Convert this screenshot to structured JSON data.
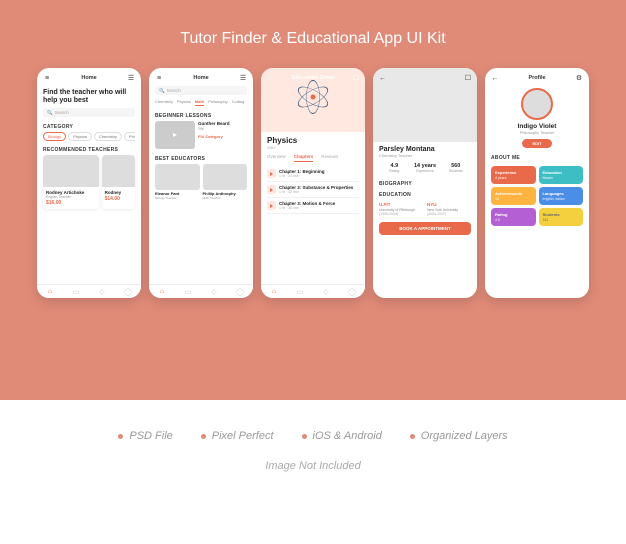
{
  "banner": {
    "title": "Tutor Finder & Educational App UI Kit"
  },
  "features": [
    "PSD File",
    "Pixel Perfect",
    "iOS & Android",
    "Organized Layers"
  ],
  "footer_note": "Image Not Included",
  "screen1": {
    "header": "Home",
    "hero": "Find the teacher who will help you best",
    "search_placeholder": "Search",
    "section_category": "CATEGORY",
    "categories": [
      "Biology",
      "Physics",
      "Chemistry",
      "Philosophy"
    ],
    "section_teachers": "RECOMMENDED TEACHERS",
    "teachers": [
      {
        "name": "Rodney Artichoke",
        "subject": "English Teacher",
        "price": "$16.00"
      },
      {
        "name": "Rodney",
        "subject": "",
        "price": "$14.00"
      }
    ]
  },
  "screen2": {
    "header": "Home",
    "search_placeholder": "Search",
    "subjects": [
      "Chemistry",
      "Physics",
      "Math",
      "Philosophy",
      "Coding"
    ],
    "section_lessons": "BEGINNER LESSONS",
    "lesson": {
      "name": "Gunther Beard",
      "views": "29k",
      "link": "FIX Category"
    },
    "section_educators": "BEST EDUCATORS",
    "educators": [
      {
        "name": "Eleanor Fant",
        "subject": "Biology Teacher"
      },
      {
        "name": "Phillip Anthrophy",
        "subject": "Math Teacher"
      }
    ]
  },
  "screen3": {
    "header": "Education Detail",
    "title": "Physics",
    "subtitle": "29k+",
    "tabs": [
      "Overview",
      "Chapters",
      "Reviews"
    ],
    "chapters": [
      {
        "name": "Chapter 1: Beginning",
        "meta": "1 hr · 24 min"
      },
      {
        "name": "Chapter 2: Substance & Properties",
        "meta": "1 hr · 42 min"
      },
      {
        "name": "Chapter 3: Motion & Force",
        "meta": "1 hr · 36 min"
      }
    ]
  },
  "screen4": {
    "name": "Parsley Montana",
    "subject": "Chemistry Teacher",
    "stats": [
      {
        "val": "4.9",
        "label": "Rating"
      },
      {
        "val": "14 years",
        "label": "Experience"
      },
      {
        "val": "560",
        "label": "Students"
      }
    ],
    "section_bio": "BIOGRAPHY",
    "section_edu": "EDUCATION",
    "education": [
      {
        "short": "U.PIT",
        "uni": "University of Pittsburgh",
        "year": "(1999-2004)"
      },
      {
        "short": "NYU",
        "uni": "New York University",
        "year": "(2004-2007)"
      }
    ],
    "cta": "BOOK A APPOINTMENT"
  },
  "screen5": {
    "header": "Profile",
    "name": "Indigo Violet",
    "subject": "Philosophy Teacher",
    "edit": "EDIT",
    "section_about": "ABOUT ME",
    "tiles": [
      {
        "label": "Experience",
        "val": "4 years"
      },
      {
        "label": "Education",
        "val": "Master"
      },
      {
        "label": "Achievements",
        "val": "16"
      },
      {
        "label": "Languages",
        "val": "english, italian"
      },
      {
        "label": "Rating",
        "val": "4.9"
      },
      {
        "label": "Students",
        "val": "312"
      }
    ]
  }
}
